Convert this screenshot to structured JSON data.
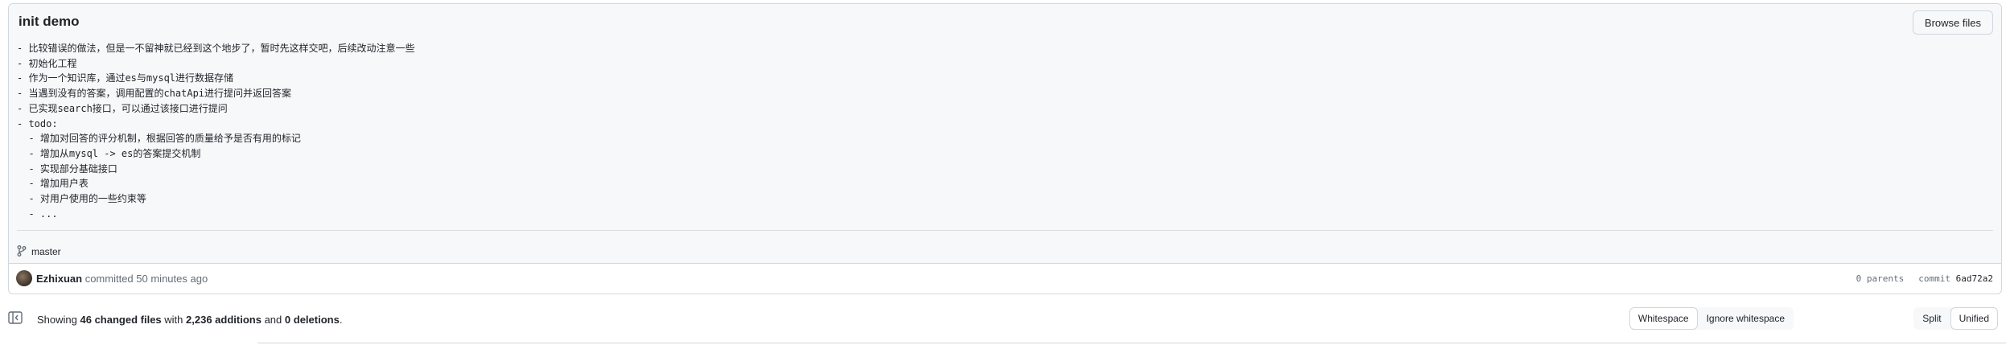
{
  "commit": {
    "title": "init demo",
    "browse_files_label": "Browse files",
    "description_lines": [
      "- 比较错误的做法，但是一不留神就已经到这个地步了，暂时先这样交吧，后续改动注意一些",
      "- 初始化工程",
      "- 作为一个知识库，通过es与mysql进行数据存储",
      "- 当遇到没有的答案，调用配置的chatApi进行提问并返回答案",
      "- 已实现search接口，可以通过该接口进行提问",
      "- todo:",
      "  - 增加对回答的评分机制，根据回答的质量给予是否有用的标记",
      "  - 增加从mysql -> es的答案提交机制",
      "  - 实现部分基础接口",
      "  - 增加用户表",
      "  - 对用户使用的一些约束等",
      "  - ..."
    ],
    "branch": "master",
    "author": "Ezhixuan",
    "committed_text": "committed 50 minutes ago",
    "parents_text": "0 parents",
    "commit_label": "commit",
    "sha": "6ad72a2"
  },
  "diff_summary": {
    "showing": "Showing",
    "changed_files": "46 changed files",
    "with": "with",
    "additions": "2,236 additions",
    "and": "and",
    "deletions": "0 deletions",
    "period": "."
  },
  "toolbar": {
    "whitespace_label": "Whitespace",
    "ignore_whitespace_label": "Ignore whitespace",
    "split_label": "Split",
    "unified_label": "Unified",
    "whitespace_selected": "Whitespace",
    "view_selected": "Unified"
  },
  "icons": {
    "branch": "git-branch-icon",
    "toc": "file-tree-toggle-icon"
  },
  "colors": {
    "header_bg": "#f6f8fa",
    "border": "#d0d7de",
    "muted_text": "#656d76"
  }
}
